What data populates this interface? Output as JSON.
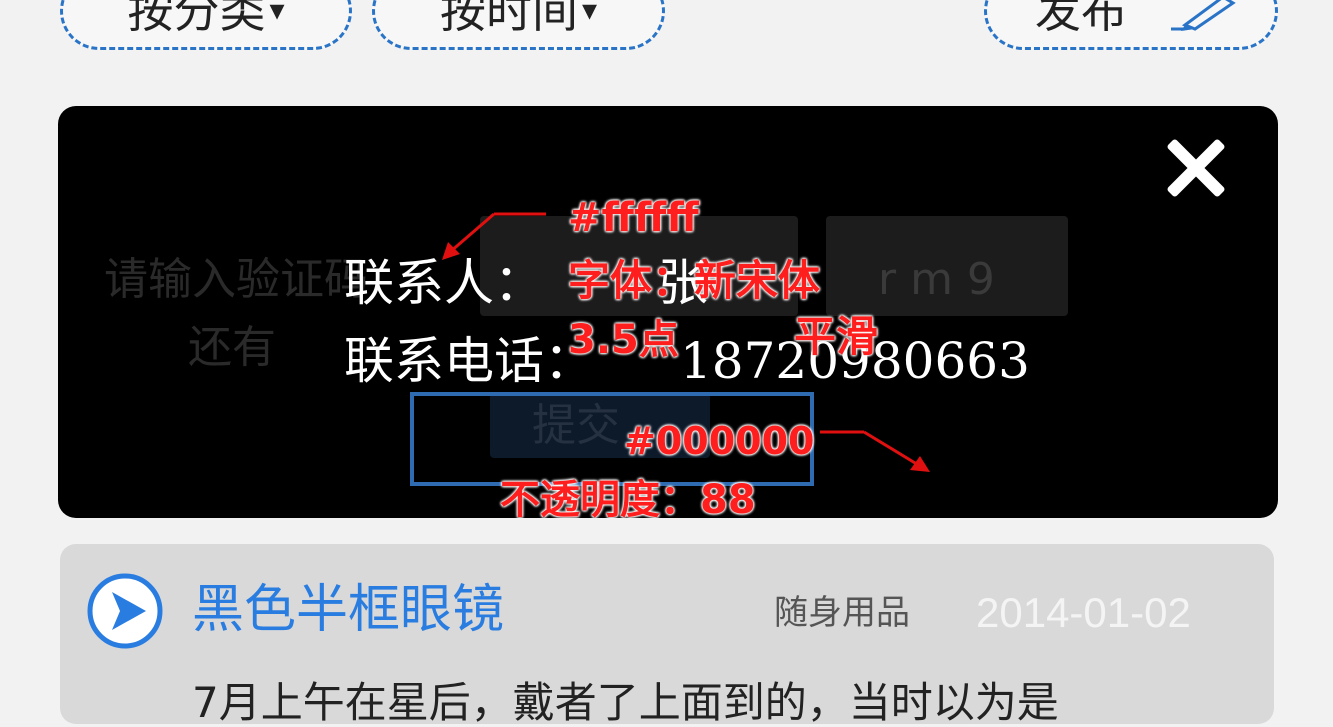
{
  "filters": {
    "category_label": "按分类",
    "time_label": "按时间",
    "caret": "▾",
    "publish_label": "发布"
  },
  "popup": {
    "background_prompt": "请输入验证码",
    "captcha_text": "r m 9",
    "background_hint": "还有",
    "background_submit": "提交",
    "contact_person_label": "联系人：",
    "contact_person_value": "张",
    "contact_phone_label": "联系电话：",
    "contact_phone_value": "18720980663"
  },
  "annotations": {
    "text_color": "#ffffff",
    "font": "字体：新宋体",
    "size": "3.5点",
    "smoothing": "平滑",
    "bg_color": "#000000",
    "opacity": "不透明度：88"
  },
  "list": {
    "items": [
      {
        "title": "黑色半框眼镜",
        "category": "随身用品",
        "date": "2014-01-02",
        "description": "7月上午在星后，戴者了上面到的，当时以为是"
      }
    ]
  },
  "colors": {
    "accent": "#2a7de0",
    "dashed_border": "#2a74c8",
    "annotation": "#ff1e1e",
    "popup_bg": "#000000"
  },
  "icons": {
    "close": "close-icon",
    "pencil": "pencil-icon",
    "play": "play-icon"
  }
}
